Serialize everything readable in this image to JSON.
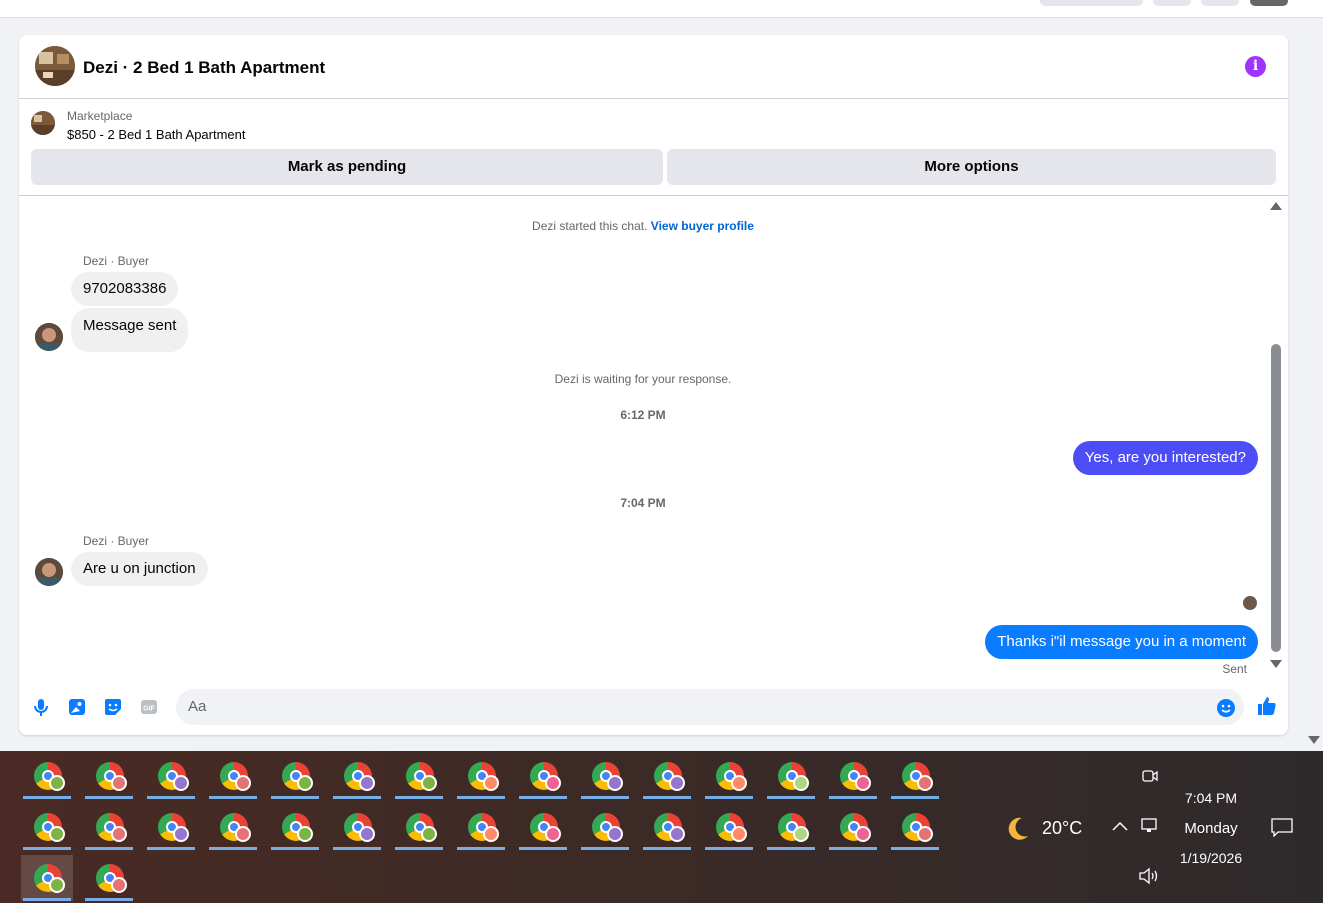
{
  "chat": {
    "title": "Dezi · 2 Bed 1 Bath Apartment",
    "listing": {
      "category": "Marketplace",
      "title": "$850 - 2 Bed 1 Bath Apartment"
    },
    "buttons": {
      "mark_pending": "Mark as pending",
      "more_options": "More options"
    },
    "started_text": "Dezi started this chat.",
    "view_profile": "View buyer profile",
    "messages": [
      {
        "sender": "Dezi · Buyer",
        "text": "9702083386"
      },
      {
        "text": "Message sent"
      },
      {
        "system": "Dezi is waiting for your response."
      },
      {
        "time": "6:12 PM"
      },
      {
        "outgoing": "Yes, are you interested?"
      },
      {
        "time": "7:04 PM"
      },
      {
        "sender": "Dezi · Buyer",
        "text": "Are u on junction"
      },
      {
        "outgoing": "Thanks i\"il message you in a moment",
        "status": "Sent"
      }
    ],
    "composer": {
      "placeholder": "Aa"
    }
  },
  "taskbar": {
    "weather": {
      "temp": "20°C"
    },
    "clock": {
      "time": "7:04 PM",
      "day": "Monday",
      "date": "1/19/2026"
    }
  },
  "colors": {
    "accent": "#0a7cff",
    "outgoing": "#4d4df5",
    "info": "#a033ff"
  }
}
